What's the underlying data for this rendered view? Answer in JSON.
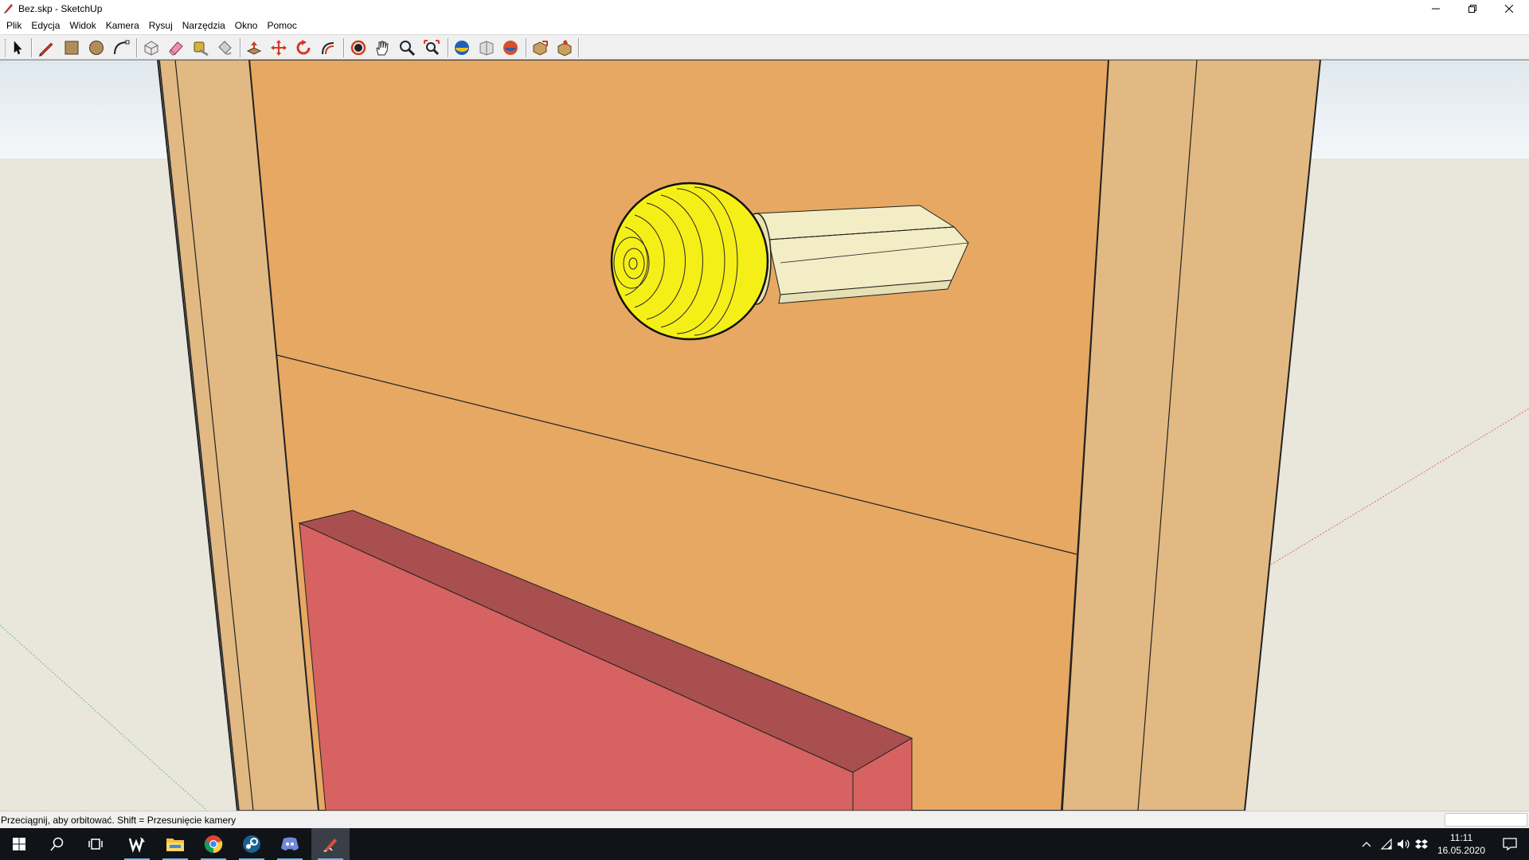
{
  "window": {
    "title": "Bez.skp - SketchUp"
  },
  "menu": {
    "items": [
      {
        "label": "Plik"
      },
      {
        "label": "Edycja"
      },
      {
        "label": "Widok"
      },
      {
        "label": "Kamera"
      },
      {
        "label": "Rysuj"
      },
      {
        "label": "Narzędzia"
      },
      {
        "label": "Okno"
      },
      {
        "label": "Pomoc"
      }
    ]
  },
  "toolbar": {
    "tools": [
      "select-tool-icon",
      "line-tool-icon",
      "rectangle-tool-icon",
      "circle-tool-icon",
      "arc-tool-icon",
      "make-component-icon",
      "eraser-tool-icon",
      "tape-measure-tool-icon",
      "paint-bucket-tool-icon",
      "push-pull-tool-icon",
      "move-tool-icon",
      "rotate-tool-icon",
      "offset-tool-icon",
      "orbit-tool-icon",
      "pan-tool-icon",
      "zoom-tool-icon",
      "zoom-extents-icon",
      "3d-warehouse-icon",
      "share-model-icon",
      "extension-warehouse-icon",
      "layout-send-icon",
      "extension-manager-icon"
    ]
  },
  "colors": {
    "sky": "#e9eff3",
    "ground": "#e9e6dc",
    "wall": "#e6a862",
    "frame": "#e2b983",
    "box_front": "#d66262",
    "box_top": "#a94f4f",
    "knob": "#f5ef18",
    "stem": "#f2edc4"
  },
  "status": {
    "text": "Przeciągnij, aby orbitować. Shift = Przesunięcie kamery"
  },
  "taskbar": {
    "apps": [
      "windows-start-icon",
      "search-icon",
      "task-view-icon",
      "wacom-icon",
      "file-explorer-icon",
      "chrome-icon",
      "steam-icon",
      "discord-icon",
      "sketchup-icon"
    ],
    "clock": {
      "time": "11:11",
      "date": "16.05.2020"
    }
  }
}
